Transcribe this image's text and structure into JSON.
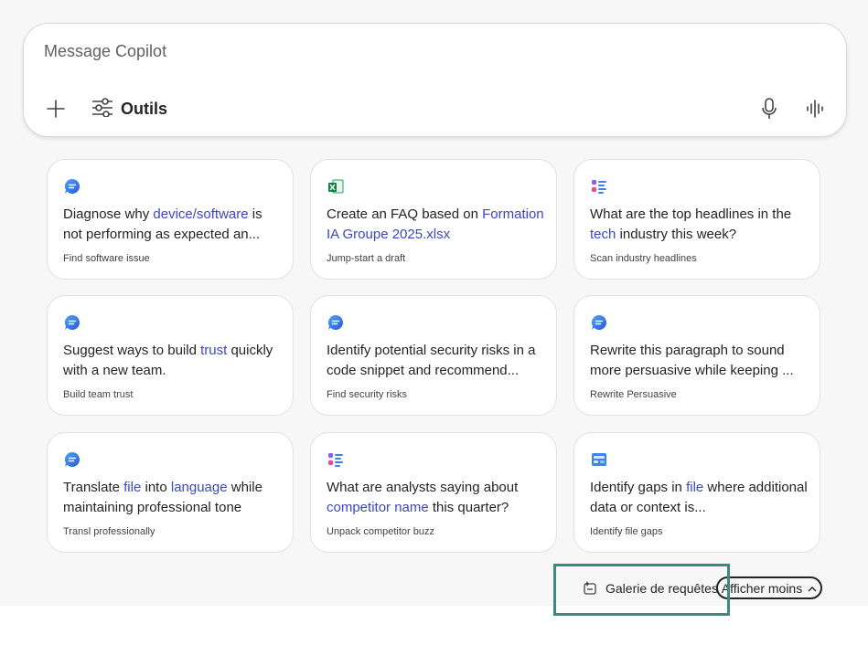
{
  "composer": {
    "placeholder": "Message Copilot",
    "tools_label": "Outils"
  },
  "cards": [
    {
      "icon": "chat-bubble-icon",
      "parts": [
        {
          "t": "Diagnose why "
        },
        {
          "t": "device/software",
          "hl": true
        },
        {
          "t": " is not performing as expected an..."
        }
      ],
      "sub": "Find software issue"
    },
    {
      "icon": "excel-file-icon",
      "parts": [
        {
          "t": "Create an FAQ based on "
        },
        {
          "t": "Formation IA Groupe 2025.xlsx",
          "hl": true
        }
      ],
      "sub": "Jump-start a draft"
    },
    {
      "icon": "list-icon",
      "parts": [
        {
          "t": "What are the top headlines in the "
        },
        {
          "t": "tech",
          "hl": true
        },
        {
          "t": " industry this week?"
        }
      ],
      "sub": "Scan industry headlines"
    },
    {
      "icon": "chat-bubble-icon",
      "parts": [
        {
          "t": "Suggest ways to build "
        },
        {
          "t": "trust",
          "hl": true
        },
        {
          "t": " quickly with a new team."
        }
      ],
      "sub": "Build team trust"
    },
    {
      "icon": "chat-bubble-icon",
      "parts": [
        {
          "t": "Identify potential security risks in a code snippet and recommend..."
        }
      ],
      "sub": "Find security risks"
    },
    {
      "icon": "chat-bubble-icon",
      "parts": [
        {
          "t": "Rewrite this paragraph to sound more persuasive while keeping ..."
        }
      ],
      "sub": "Rewrite Persuasive"
    },
    {
      "icon": "chat-bubble-icon",
      "parts": [
        {
          "t": "Translate "
        },
        {
          "t": "file",
          "hl": true
        },
        {
          "t": " into "
        },
        {
          "t": "language",
          "hl": true
        },
        {
          "t": " while maintaining professional tone"
        }
      ],
      "sub": "Transl professionally"
    },
    {
      "icon": "list-icon",
      "parts": [
        {
          "t": "What are analysts saying about "
        },
        {
          "t": "competitor name",
          "hl": true
        },
        {
          "t": " this quarter?"
        }
      ],
      "sub": "Unpack competitor buzz"
    },
    {
      "icon": "document-icon",
      "parts": [
        {
          "t": "Identify gaps in "
        },
        {
          "t": "file",
          "hl": true
        },
        {
          "t": " where additional data or context is..."
        }
      ],
      "sub": "Identify file gaps"
    }
  ],
  "footer": {
    "gallery_label": "Galerie de requêtes",
    "show_less_label": "Afficher moins"
  },
  "colors": {
    "highlight": "#3b47c4",
    "focus_outline": "#3d8a7c"
  }
}
